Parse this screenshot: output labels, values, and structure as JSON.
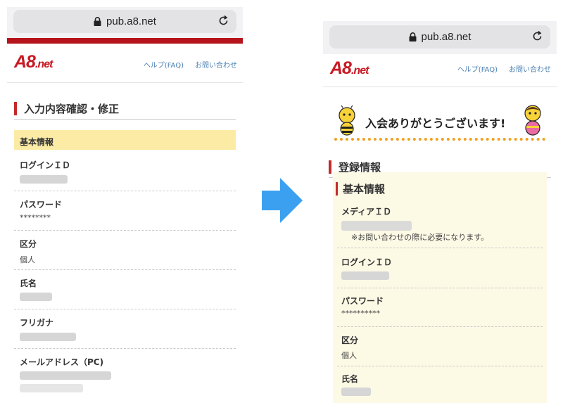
{
  "browser": {
    "url": "pub.a8.net"
  },
  "site": {
    "logo_main": "A8",
    "logo_suffix": ".net",
    "help_link": "ヘルプ(FAQ)",
    "contact_link": "お問い合わせ"
  },
  "left": {
    "section_title": "入力内容確認・修正",
    "basic_info_heading": "基本情報",
    "fields": [
      {
        "label": "ログインＩＤ",
        "value": ""
      },
      {
        "label": "パスワード",
        "value": "********"
      },
      {
        "label": "区分",
        "value": "個人"
      },
      {
        "label": "氏名",
        "value": ""
      },
      {
        "label": "フリガナ",
        "value": ""
      },
      {
        "label": "メールアドレス（PC)",
        "value": ""
      }
    ]
  },
  "right": {
    "welcome_message": "入会ありがとうございます!",
    "section_title": "登録情報",
    "sub_title": "基本情報",
    "fields": [
      {
        "label": "メディアＩＤ",
        "value": "",
        "note": "※お問い合わせの際に必要になります。"
      },
      {
        "label": "ログインＩＤ",
        "value": ""
      },
      {
        "label": "パスワード",
        "value": "**********"
      },
      {
        "label": "区分",
        "value": "個人"
      },
      {
        "label": "氏名",
        "value": ""
      }
    ]
  },
  "colors": {
    "brand_red": "#c81a24",
    "accent_blue": "#3ca0f0",
    "highlight_yellow": "#fbeba5",
    "cream": "#fcf9e5"
  }
}
